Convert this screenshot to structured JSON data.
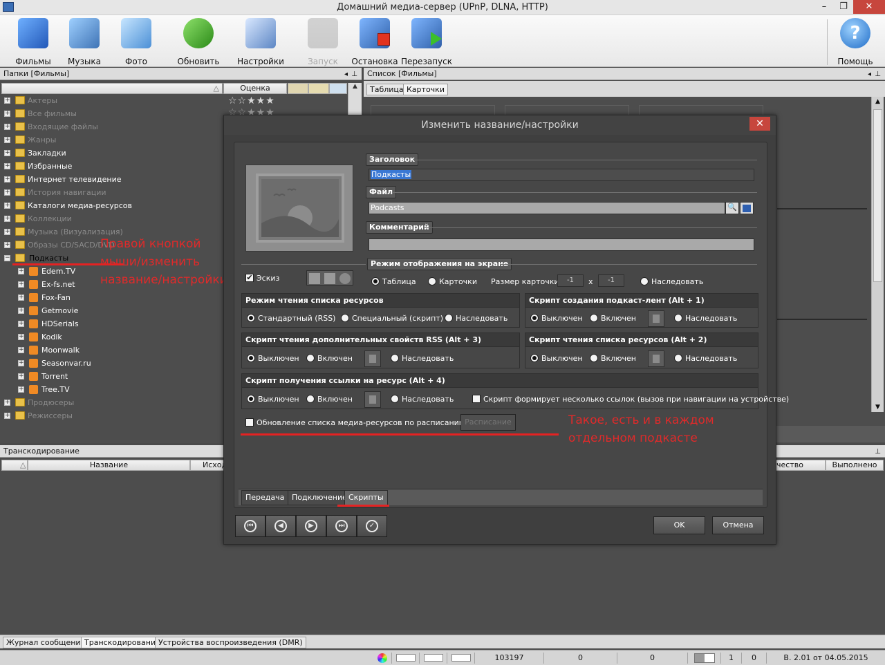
{
  "window": {
    "title": "Домашний медиа-сервер (UPnP, DLNA, HTTP)",
    "minimize": "–",
    "maximize": "❐",
    "close": "✕"
  },
  "toolbar": {
    "movies": "Фильмы",
    "music": "Музыка",
    "photo": "Фото",
    "refresh": "Обновить",
    "settings": "Настройки",
    "launch": "Запуск",
    "stop": "Остановка",
    "restart": "Перезапуск",
    "help": "Помощь"
  },
  "left_panel": {
    "header": "Папки [Фильмы]",
    "col_rating": "Оценка",
    "tree": [
      "Актеры",
      "Все фильмы",
      "Входящие файлы",
      "Жанры",
      "Закладки",
      "Избранные",
      "Интернет телевидение",
      "История навигации",
      "Каталоги медиа-ресурсов",
      "Коллекции",
      "Музыка (Визуализация)",
      "Образы CD/SACD/DVD",
      "Подкасты"
    ],
    "podcasts": [
      "Edem.TV",
      "Ex-fs.net",
      "Fox-Fan",
      "Getmovie",
      "HDSerials",
      "Kodik",
      "Moonwalk",
      "Seasonvar.ru",
      "Torrent",
      "Tree.TV"
    ],
    "tree_tail": [
      "Продюсеры",
      "Режиссеры"
    ]
  },
  "right_panel": {
    "header": "Список [Фильмы]",
    "tab_table": "Таблица",
    "tab_cards": "Карточки"
  },
  "transcode": {
    "header": "Транскодирование",
    "col_name": "Название",
    "col_source": "Исход",
    "col_quality": "чество",
    "col_done": "Выполнено"
  },
  "bottom_tabs": [
    "Журнал сообщений",
    "Транскодирование",
    "Устройства воспроизведения (DMR)"
  ],
  "status": {
    "count": "103197",
    "v1": "0",
    "v2": "0",
    "v3": "1",
    "v4": "0",
    "version": "В. 2.01 от 04.05.2015"
  },
  "dialog": {
    "title": "Изменить название/настройки",
    "close": "✕",
    "label_title": "Заголовок",
    "title_value": "Подкасты",
    "label_file": "Файл",
    "file_value": "Podcasts",
    "label_comment": "Комментарий",
    "comment_value": "",
    "display_mode": "Режим отображения на экране",
    "sketch": "Эскиз",
    "opt_table": "Таблица",
    "opt_cards": "Карточки",
    "card_size": "Размер карточки",
    "card_w": "-1",
    "card_x": "x",
    "card_h": "-1",
    "inherit": "Наследовать",
    "group_read_mode": "Режим чтения списка ресурсов",
    "opt_standard": "Стандартный (RSS)",
    "opt_special": "Специальный (скрипт)",
    "group_podcast_script": "Скрипт создания подкаст-лент (Alt + 1)",
    "off": "Выключен",
    "on": "Включен",
    "group_rss_props": "Скрипт чтения дополнительных свойств RSS (Alt + 3)",
    "group_read_script": "Скрипт чтения списка ресурсов (Alt + 2)",
    "group_link_script": "Скрипт получения ссылки на ресурс (Alt + 4)",
    "multi_links": "Скрипт формирует несколько ссылок (вызов при навигации на устройстве)",
    "schedule_update": "Обновление списка медиа-ресурсов по расписанию",
    "schedule_btn": "Расписание",
    "tab_transfer": "Передача",
    "tab_connection": "Подключение",
    "tab_scripts": "Скрипты",
    "ok": "OK",
    "cancel": "Отмена"
  },
  "annotations": {
    "right_click": "Правой кнопкой\nмыши/изменить\nназвание/настройки",
    "each_podcast": "Такое, есть и в каждом\nотдельном подкасте"
  },
  "colors": {
    "accent_red": "#e02a2a",
    "selection": "#cde7ff",
    "close_red": "#c7463d"
  }
}
